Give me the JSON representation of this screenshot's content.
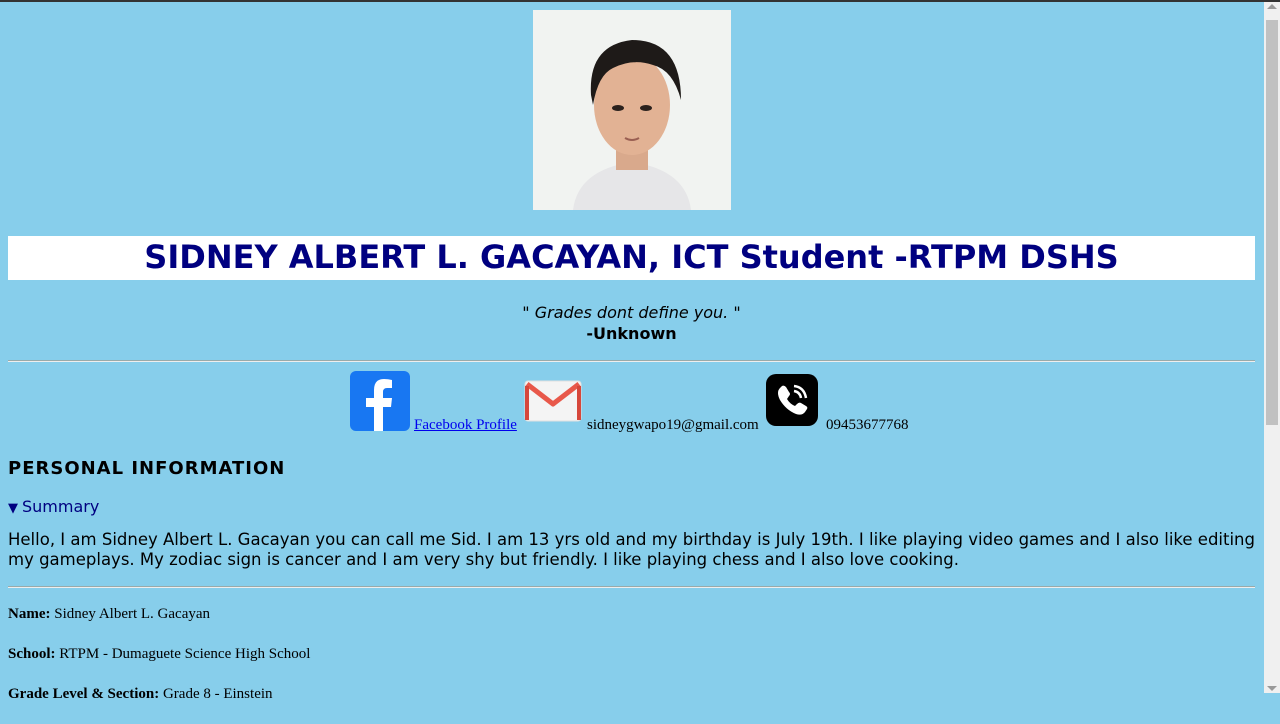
{
  "profile": {
    "photo_alt": "profile photo",
    "title": "SIDNEY ALBERT L. GACAYAN, ICT Student -RTPM DSHS",
    "quote": "\" Grades dont define you. \"",
    "quote_author": "-Unknown"
  },
  "contacts": {
    "facebook_label": "Facebook Profile ",
    "email": "sidneygwapo19@gmail.com",
    "phone": "09453677768"
  },
  "personal": {
    "heading": "PERSONAL INFORMATION",
    "summary_label": "Summary",
    "summary_marker": "▼",
    "bio": "Hello, I am Sidney Albert L. Gacayan you can call me Sid. I am 13 yrs old and my birthday is July 19th. I like playing video games and I also like editing my gameplays. My zodiac sign is cancer and I am very shy but friendly. I like playing chess and I also love cooking.",
    "fields": [
      {
        "label": "Name:",
        "value": " Sidney Albert L. Gacayan"
      },
      {
        "label": "School:",
        "value": " RTPM - Dumaguete Science High School"
      },
      {
        "label": "Grade Level & Section:",
        "value": " Grade 8 - Einstein"
      }
    ]
  },
  "colors": {
    "background": "#87ceeb",
    "title_text": "#000080",
    "link": "#0000ee"
  },
  "icons": [
    "facebook-icon",
    "email-icon",
    "viber-phone-icon"
  ]
}
